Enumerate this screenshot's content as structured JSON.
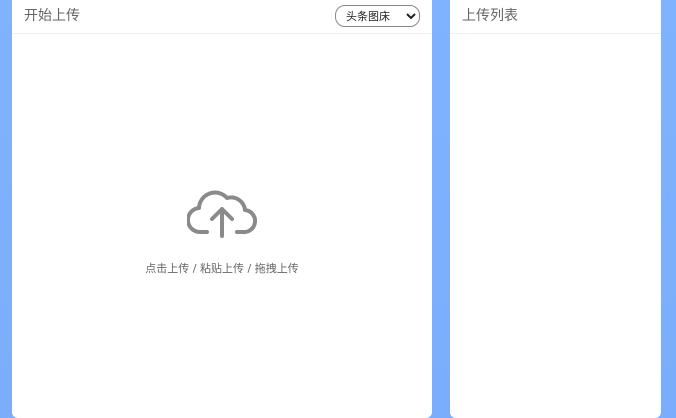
{
  "upload_panel": {
    "title": "开始上传",
    "host_select": {
      "selected": "头条图床",
      "options": [
        "头条图床"
      ]
    },
    "cloud_icon": "cloud-upload-icon",
    "hint": "点击上传 / 粘贴上传 / 拖拽上传"
  },
  "list_panel": {
    "title": "上传列表"
  },
  "colors": {
    "background": "#7fb3ff",
    "panel": "#ffffff",
    "icon": "#8a8a8a",
    "text": "#666666"
  }
}
